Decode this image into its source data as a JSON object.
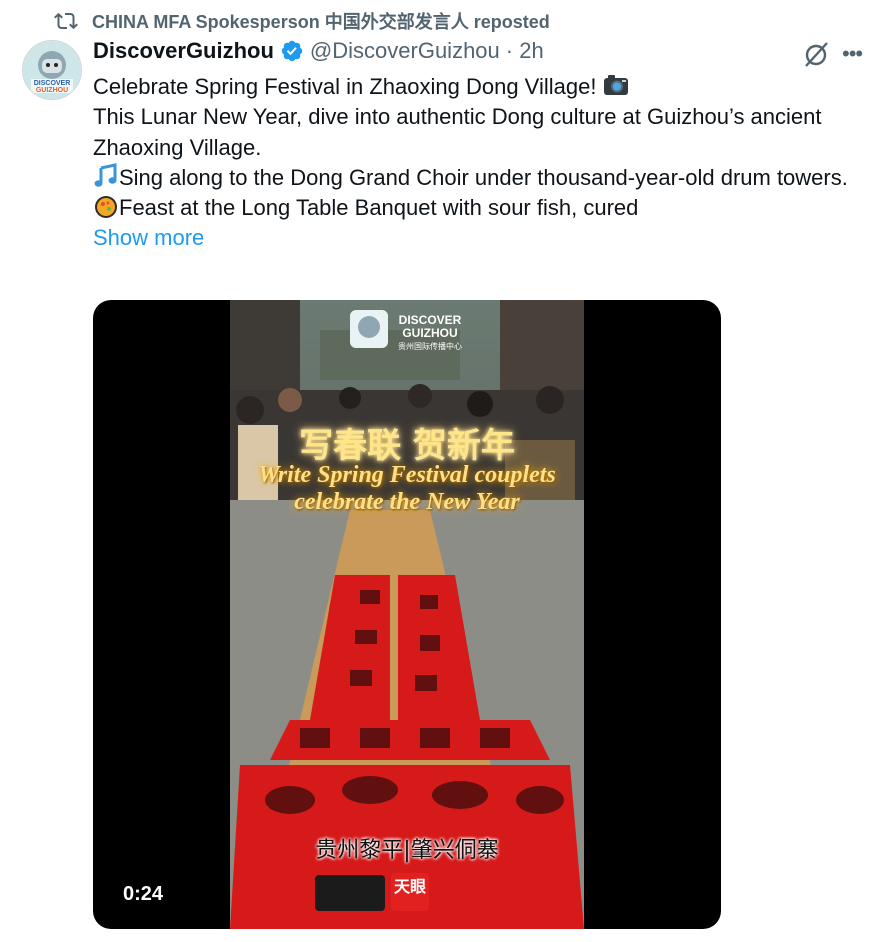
{
  "repost": {
    "text": "CHINA MFA Spokesperson 中国外交部发言人 reposted"
  },
  "author": {
    "display_name": "DiscoverGuizhou",
    "handle": "@DiscoverGuizhou",
    "time": "· 2h",
    "avatar_text": "DISCOVER GUIZHOU"
  },
  "tweet": {
    "lines": [
      "Celebrate Spring Festival in Zhaoxing Dong Village! ",
      "This Lunar New Year, dive into authentic Dong culture at Guizhou’s ancient Zhaoxing Village.",
      "Sing along to the Dong Grand Choir under thousand-year-old drum towers.",
      "Feast at the Long Table Banquet with sour fish, cured"
    ],
    "show_more": "Show more"
  },
  "media": {
    "timestamp": "0:24",
    "logo_title": "DISCOVER GUIZHOU",
    "logo_subtitle": "贵州国际传播中心",
    "overlay_cn": "写春联 贺新年",
    "overlay_en": "Write Spring Festival couplets celebrate the New Year",
    "location": "贵州黎平|肇兴侗寨",
    "badge": "天眼"
  },
  "colors": {
    "link": "#1d9bf0",
    "verified": "#1d9bf0",
    "muted": "#536471",
    "couplet_red": "#d61a1a"
  }
}
